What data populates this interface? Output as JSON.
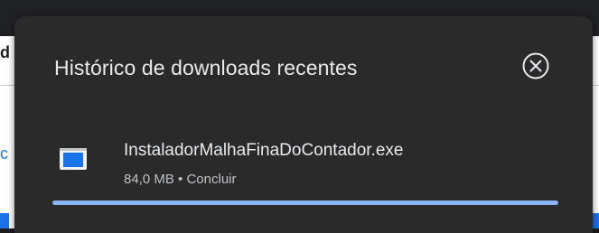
{
  "page_bg": {
    "edge_glyph_top": "d",
    "edge_glyph_mid": "c"
  },
  "downloads": {
    "title": "Histórico de downloads recentes",
    "close_icon": "close-circle-icon",
    "items": [
      {
        "file_icon": "application-file-icon",
        "name": "InstaladorMalhaFinaDoContador.exe",
        "size": "84,0 MB",
        "separator": " • ",
        "status": "Concluir",
        "progress": 1.0
      }
    ]
  },
  "colors": {
    "bubble_bg": "#2a2a2a",
    "title_text": "#e8eaed",
    "status_text": "#bdc1c6",
    "accent": "#8ab4f8",
    "file_icon_blue": "#1a73e8"
  }
}
